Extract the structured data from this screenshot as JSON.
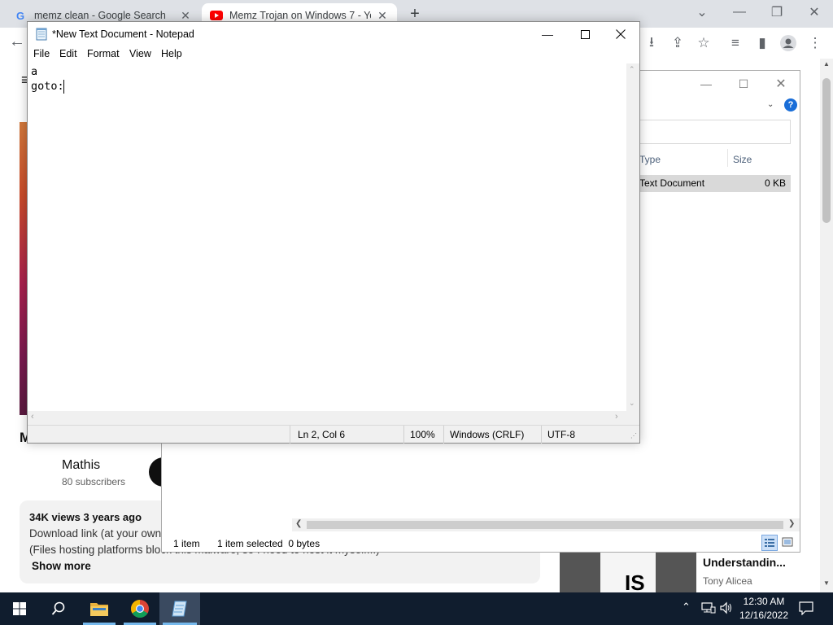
{
  "browser": {
    "tabs": [
      {
        "title": "memz clean - Google Search",
        "favicon": "google-icon"
      },
      {
        "title": "Memz Trojan on Windows 7 - You",
        "favicon": "youtube-icon"
      }
    ],
    "new_tab_label": "+"
  },
  "youtube": {
    "channel_name": "Mathis",
    "subscribers": "80 subscribers",
    "views_line": "34K views  3 years ago",
    "description_line1": "Download link (at your own",
    "description_line2": "(Files hosting platforms block this malware, so I need to host it myself...)",
    "show_more": "Show more",
    "video_title_partial": "M...",
    "suggested_title": "Understandin...",
    "suggested_author": "Tony Alicea"
  },
  "explorer": {
    "col_type": "Type",
    "col_size": "Size",
    "row_type": "Text Document",
    "row_size": "0 KB",
    "status_items": "1 item",
    "status_selected": "1 item selected  0 bytes",
    "help_icon": "?"
  },
  "notepad": {
    "title": "*New Text Document - Notepad",
    "menu": [
      "File",
      "Edit",
      "Format",
      "View",
      "Help"
    ],
    "content_lines": [
      "a",
      "goto:"
    ],
    "status": {
      "position": "Ln 2, Col 6",
      "zoom": "100%",
      "line_ending": "Windows (CRLF)",
      "encoding": "UTF-8"
    }
  },
  "taskbar": {
    "time": "12:30 AM",
    "date": "12/16/2022"
  },
  "colors": {
    "taskbar_bg": "#101d2e",
    "chrome_tabbar": "#dee1e6",
    "youtube_red": "#ff0000"
  }
}
